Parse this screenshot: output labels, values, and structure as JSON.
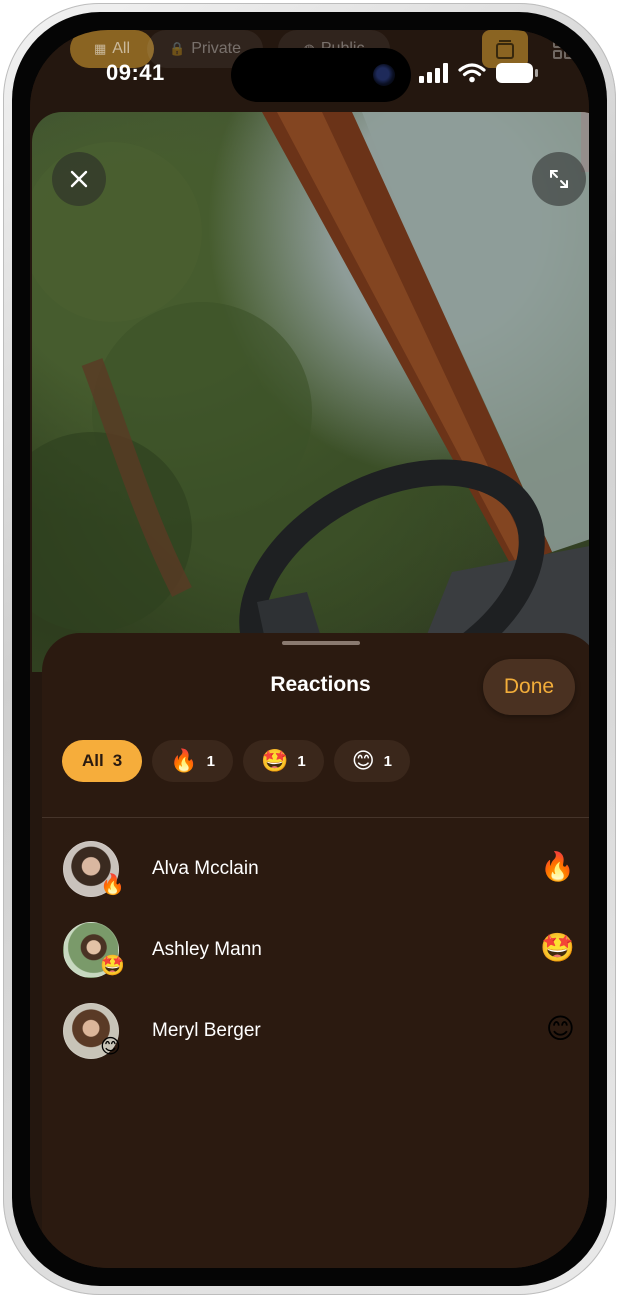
{
  "status_bar": {
    "time": "09:41"
  },
  "filters": [
    {
      "label": "All",
      "icon": "grid-icon",
      "active": true
    },
    {
      "label": "Private",
      "icon": "lock-icon",
      "active": false
    },
    {
      "label": "Public",
      "icon": "globe-icon",
      "active": false
    }
  ],
  "sheet": {
    "title": "Reactions",
    "done_label": "Done",
    "tabs": [
      {
        "label": "All",
        "count": "3",
        "active": true
      },
      {
        "emoji": "🔥",
        "count": "1"
      },
      {
        "emoji": "🤩",
        "count": "1"
      },
      {
        "emoji": "😊",
        "count": "1"
      }
    ],
    "reactions": [
      {
        "name": "Alva Mcclain",
        "emoji": "🔥"
      },
      {
        "name": "Ashley Mann",
        "emoji": "🤩"
      },
      {
        "name": "Meryl Berger",
        "emoji": "😊"
      }
    ]
  },
  "colors": {
    "accent": "#f6ad3b",
    "sheet_bg": "#2b1a10",
    "done_text": "#f2ad3a"
  }
}
